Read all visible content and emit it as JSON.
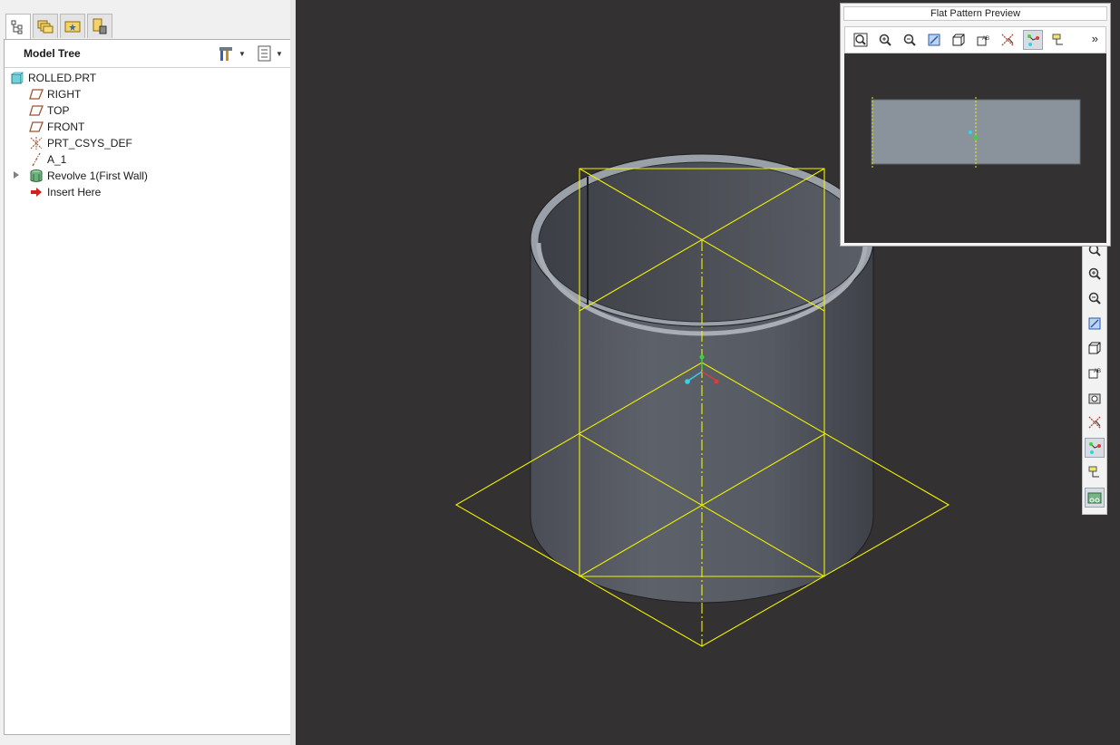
{
  "left_panel": {
    "nav_tabs": [
      {
        "name": "model-tree-tab-icon",
        "active": true
      },
      {
        "name": "folder-browser-tab-icon",
        "active": false
      },
      {
        "name": "favorites-tab-icon",
        "active": false
      },
      {
        "name": "layers-tab-icon",
        "active": false
      }
    ],
    "model_tree": {
      "title": "Model Tree",
      "settings_icon": "tree-settings-icon",
      "show_icon": "tree-show-icon",
      "items": [
        {
          "label": "ROLLED.PRT",
          "icon": "part-icon",
          "indent": 0,
          "expandable": false
        },
        {
          "label": "RIGHT",
          "icon": "datum-plane-icon",
          "indent": 1,
          "expandable": false
        },
        {
          "label": "TOP",
          "icon": "datum-plane-icon",
          "indent": 1,
          "expandable": false
        },
        {
          "label": "FRONT",
          "icon": "datum-plane-icon",
          "indent": 1,
          "expandable": false
        },
        {
          "label": "PRT_CSYS_DEF",
          "icon": "coordinate-system-icon",
          "indent": 1,
          "expandable": false
        },
        {
          "label": "A_1",
          "icon": "datum-axis-icon",
          "indent": 1,
          "expandable": false
        },
        {
          "label": "Revolve 1(First Wall)",
          "icon": "revolve-wall-icon",
          "indent": 1,
          "expandable": true
        },
        {
          "label": "Insert Here",
          "icon": "insert-here-arrow-icon",
          "indent": 1,
          "expandable": false
        }
      ]
    }
  },
  "preview": {
    "title": "Flat Pattern Preview",
    "tools": [
      {
        "name": "refit-icon",
        "pressed": false
      },
      {
        "name": "zoom-in-icon",
        "pressed": false
      },
      {
        "name": "zoom-out-icon",
        "pressed": false
      },
      {
        "name": "repaint-icon",
        "pressed": false
      },
      {
        "name": "display-style-icon",
        "pressed": false
      },
      {
        "name": "saved-orientations-icon",
        "pressed": false
      },
      {
        "name": "datum-display-icon",
        "pressed": false
      },
      {
        "name": "csys-display-icon",
        "pressed": true
      },
      {
        "name": "annotation-display-icon",
        "pressed": false
      }
    ],
    "more_label": "»"
  },
  "right_toolbar": {
    "tools": [
      {
        "name": "refit-icon",
        "pressed": false
      },
      {
        "name": "zoom-in-icon",
        "pressed": false
      },
      {
        "name": "zoom-out-icon",
        "pressed": false
      },
      {
        "name": "repaint-icon",
        "pressed": false
      },
      {
        "name": "display-style-icon",
        "pressed": false
      },
      {
        "name": "saved-orientations-icon",
        "pressed": false
      },
      {
        "name": "view-manager-icon",
        "pressed": false
      },
      {
        "name": "datum-display-icon",
        "pressed": false
      },
      {
        "name": "csys-display-icon",
        "pressed": true
      },
      {
        "name": "annotation-display-icon",
        "pressed": false
      },
      {
        "name": "flat-pattern-preview-icon",
        "pressed": true
      }
    ]
  },
  "colors": {
    "viewport_bg": "#333131",
    "datum_yellow": "#f2f200",
    "wall_gray": "#60646c",
    "flat_pattern_fill": "#8a939b"
  }
}
